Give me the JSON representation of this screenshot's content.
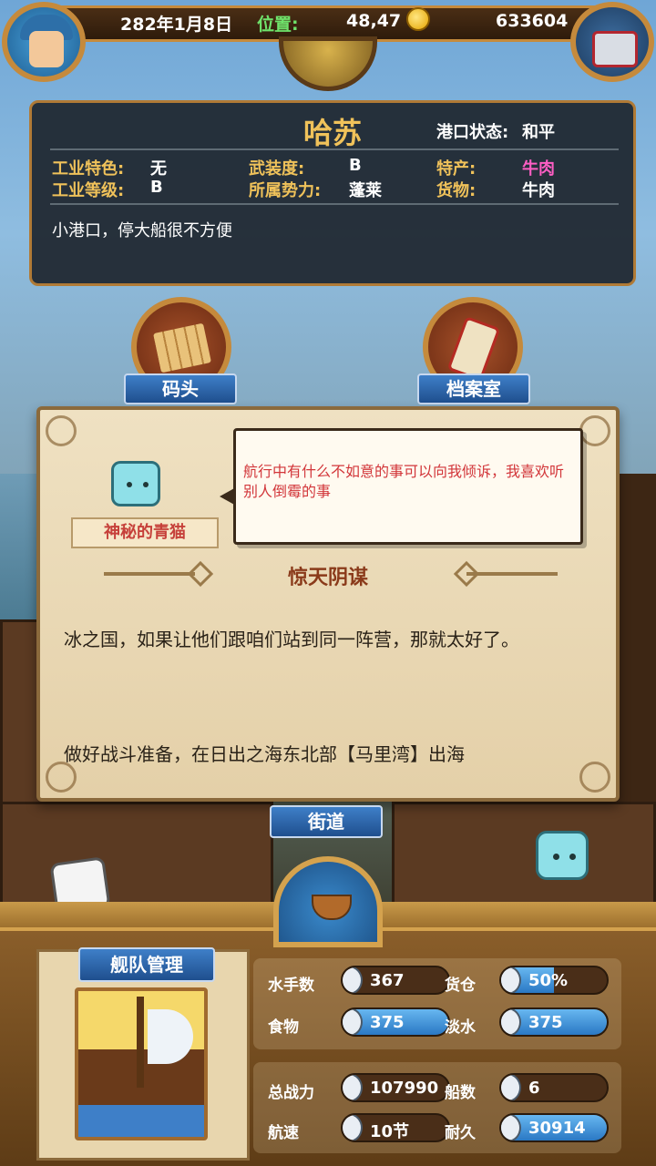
{
  "topbar": {
    "date": "282年1月8日",
    "position_label": "位置:",
    "position": "48,47",
    "gold": "633604"
  },
  "port": {
    "name": "哈苏",
    "status_label": "港口状态:",
    "status": "和平",
    "industry_feature_label": "工业特色:",
    "industry_feature": "无",
    "industry_level_label": "工业等级:",
    "industry_level": "B",
    "armament_label": "武装度:",
    "armament": "B",
    "faction_label": "所属势力:",
    "faction": "蓬莱",
    "specialty_label": "特产:",
    "specialty": "牛肉",
    "goods_label": "货物:",
    "goods": "牛肉",
    "description": "小港口，停大船很不方便",
    "specialty_color": "#ff5ec4"
  },
  "buildings": {
    "dock": "码头",
    "archive": "档案室",
    "street": "街道"
  },
  "dialog": {
    "npc_name": "神秘的青猫",
    "speech": "航行中有什么不如意的事可以向我倾诉，我喜欢听别人倒霉的事",
    "quest_title": "惊天阴谋",
    "quest_body": "冰之国，如果让他们跟咱们站到同一阵营，那就太好了。",
    "quest_hint": "做好战斗准备，在日出之海东北部【马里湾】出海"
  },
  "fleet": {
    "title": "舰队管理",
    "sailors_label": "水手数",
    "sailors": "367",
    "cargo_label": "货仓",
    "cargo": "50%",
    "food_label": "食物",
    "food": "375",
    "water_label": "淡水",
    "water": "375",
    "power_label": "总战力",
    "power": "107990",
    "ships_label": "船数",
    "ships": "6",
    "speed_label": "航速",
    "speed": "10节",
    "durability_label": "耐久",
    "durability": "30914",
    "cargo_fill": 0.5,
    "food_fill": 1.0,
    "water_fill": 1.0,
    "durability_fill": 1.0
  }
}
